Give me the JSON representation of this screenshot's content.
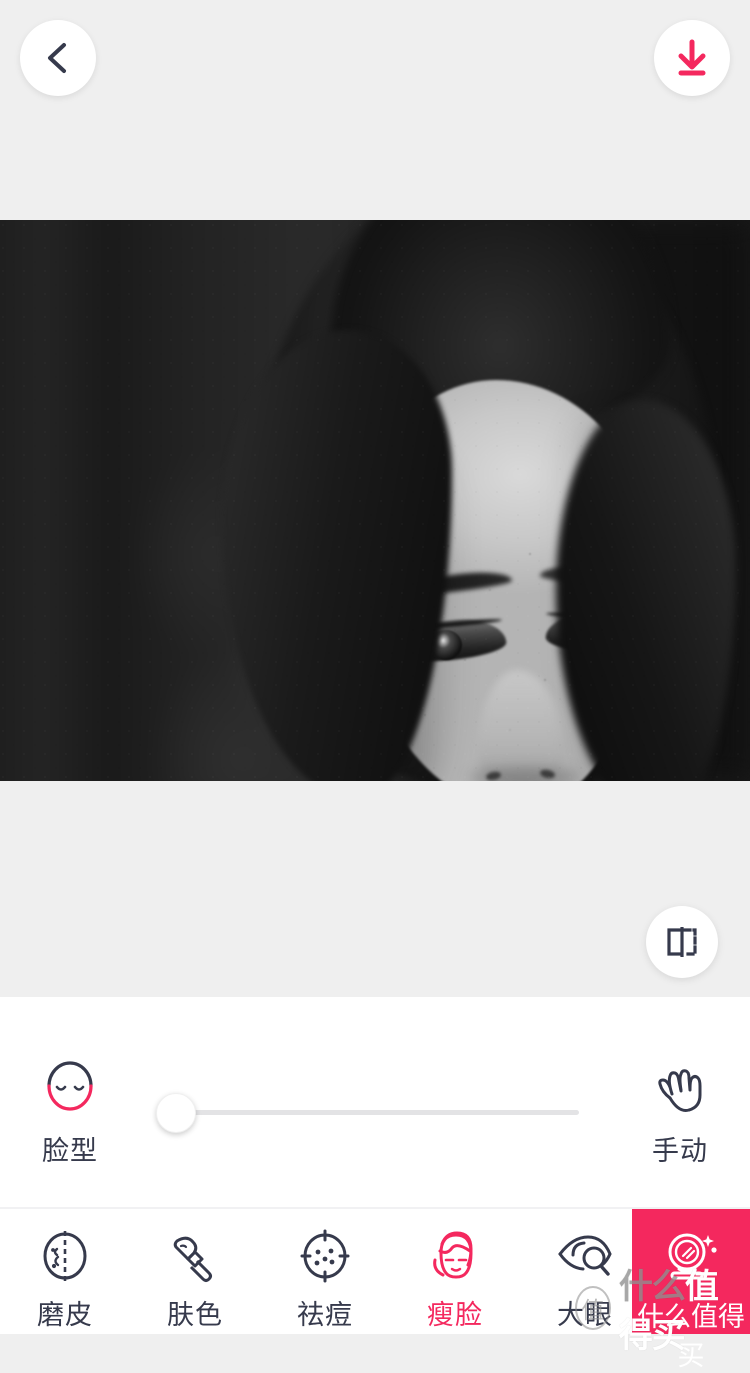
{
  "app": {
    "accent_color": "#f4285e",
    "dark_color": "#363a4c",
    "panel_bg": "#ffffff",
    "page_bg": "#efefef"
  },
  "topbar": {
    "back_button": {
      "name": "back",
      "icon": "chevron-left-icon"
    },
    "download_button": {
      "name": "download",
      "icon": "download-icon"
    }
  },
  "photo": {
    "alt": "Black and white close-up portrait of a young woman with freckles looking down",
    "compare_button": {
      "label": "",
      "icon": "compare-split-icon"
    }
  },
  "slider_row": {
    "left_tool": {
      "label": "脸型",
      "icon": "face-shape-icon"
    },
    "right_tool": {
      "label": "手动",
      "icon": "manual-hand-icon"
    },
    "slider": {
      "value": 0,
      "min": 0,
      "max": 100
    }
  },
  "toolbar": {
    "items": [
      {
        "label": "磨皮",
        "icon": "skin-smooth-icon",
        "active": false
      },
      {
        "label": "肤色",
        "icon": "makeup-brush-icon",
        "active": false
      },
      {
        "label": "祛痘",
        "icon": "acne-target-icon",
        "active": false
      },
      {
        "label": "瘦脸",
        "icon": "face-slim-icon",
        "active": true
      },
      {
        "label": "大眼",
        "icon": "big-eye-icon",
        "active": false
      }
    ],
    "beauty_button": {
      "label": "什么值得买",
      "icon": "vanity-mirror-icon"
    }
  },
  "watermark": {
    "badge": "值",
    "text_gray": "什么",
    "text_white": "值得买",
    "full_text": "什么值得买"
  }
}
